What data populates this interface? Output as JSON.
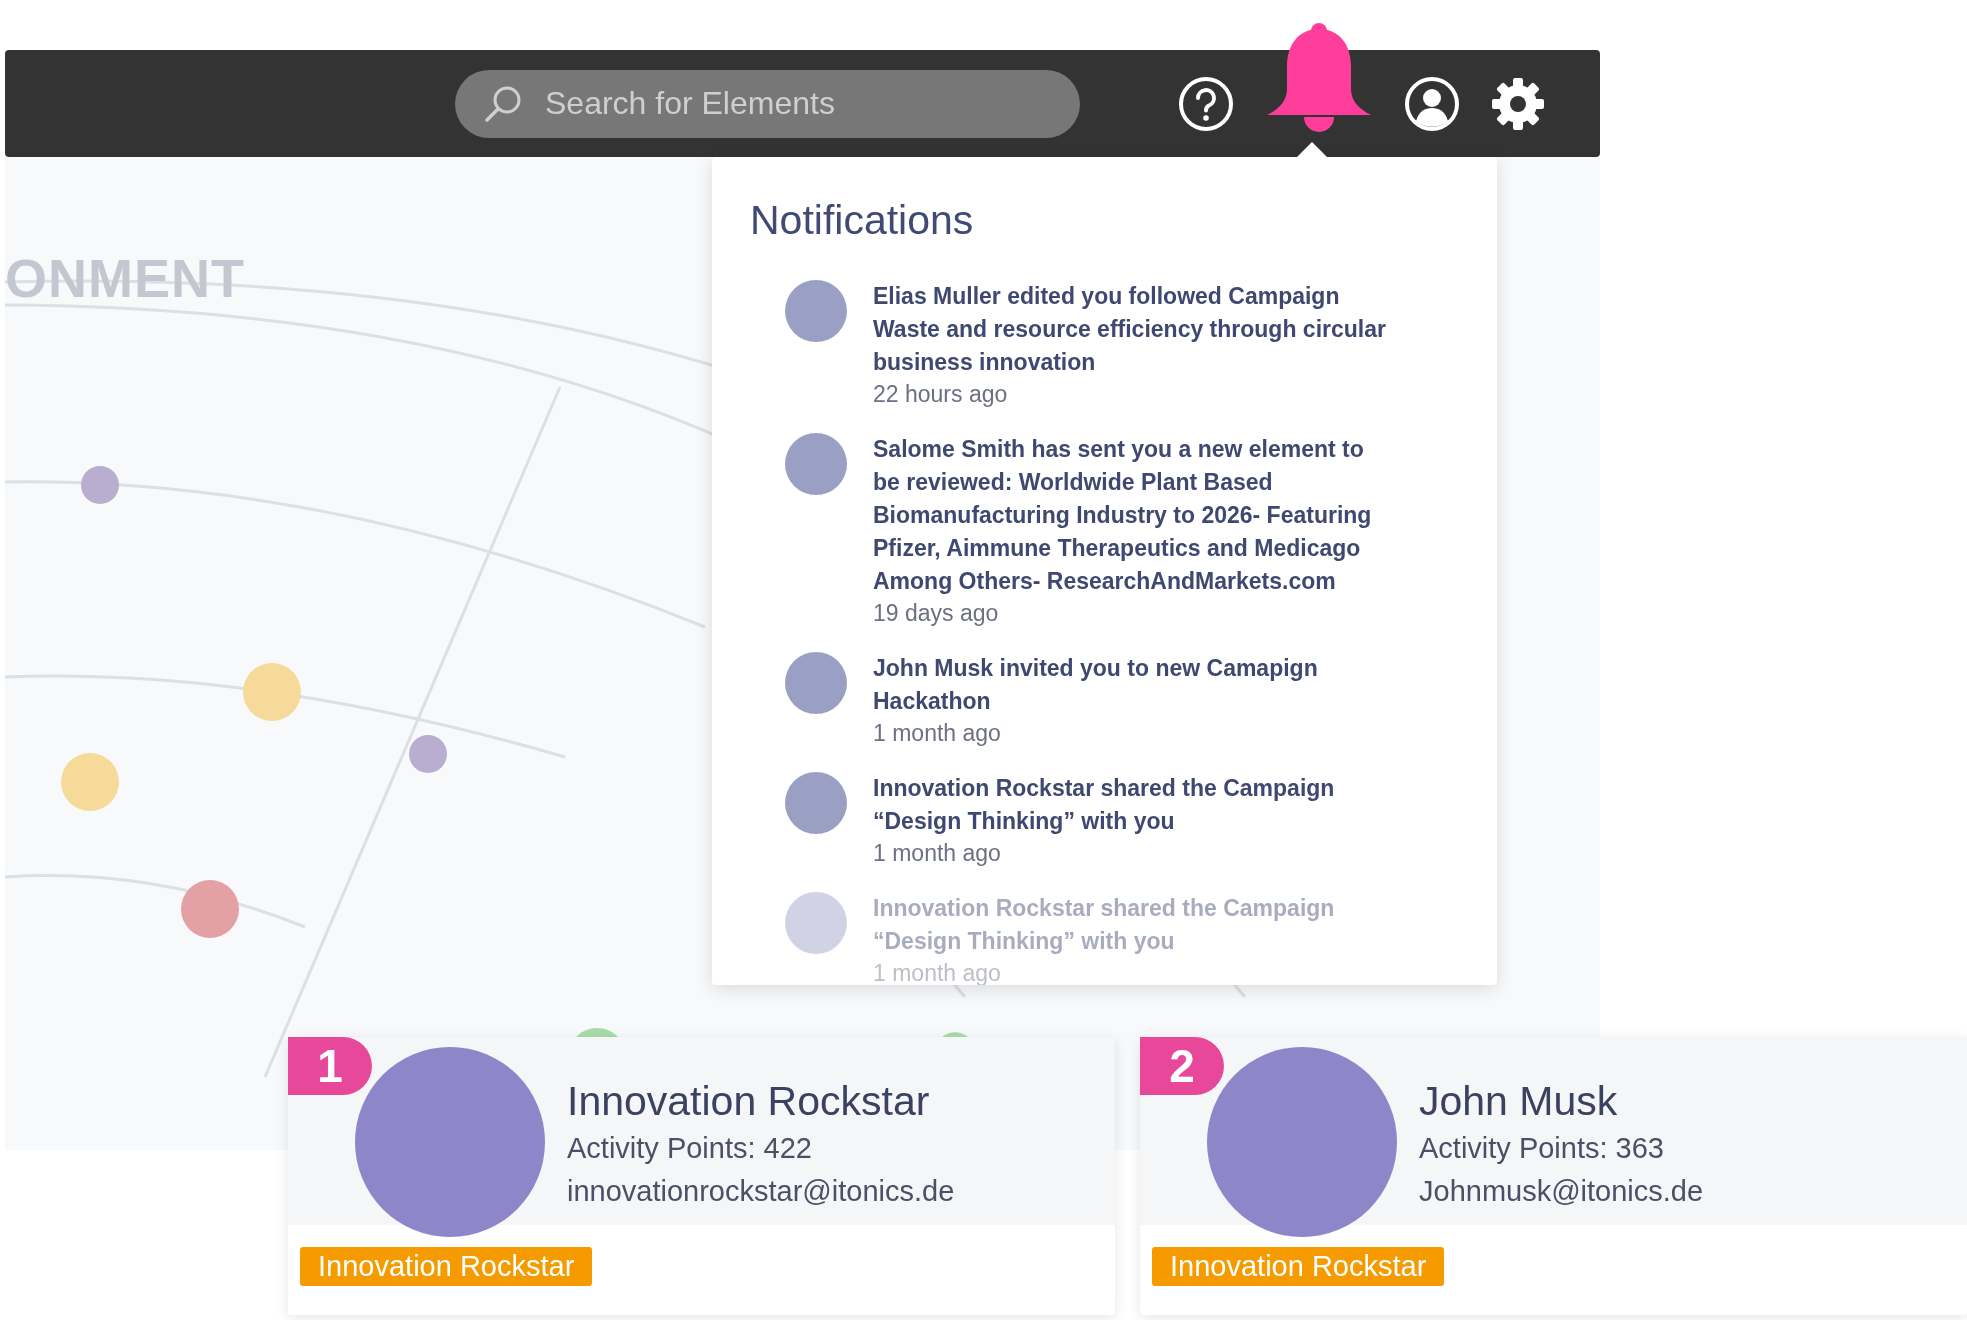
{
  "top_bar": {
    "search": {
      "placeholder": "Search for Elements"
    },
    "icons": [
      {
        "kind": "help",
        "selected": false
      },
      {
        "kind": "bell",
        "selected": true
      },
      {
        "kind": "user",
        "selected": false
      },
      {
        "kind": "settings",
        "selected": false
      }
    ]
  },
  "page": {
    "heading": "ONMENT"
  },
  "notifications": {
    "title": "Notifications",
    "items": [
      {
        "text": "Elias Muller edited you followed Campaign Waste and resource efficiency through circular business innovation",
        "time": "22 hours ago",
        "faded": false
      },
      {
        "text": "Salome Smith has sent you a new element to be reviewed: Worldwide Plant Based Biomanufacturing Industry to 2026- Featuring Pfizer, Aimmune Therapeutics and Medicago Among Others- ResearchAndMarkets.com",
        "time": "19 days ago",
        "faded": false
      },
      {
        "text": "John Musk invited you to new Camapign Hackathon",
        "time": "1 month ago",
        "faded": false
      },
      {
        "text": "Innovation Rockstar shared the Campaign “Design Thinking” with you",
        "time": "1 month ago",
        "faded": false
      },
      {
        "text": "Innovation Rockstar shared the Campaign “Design Thinking” with you",
        "time": "1 month ago",
        "faded": true
      }
    ]
  },
  "leaderboard": [
    {
      "rank": "1",
      "name": "Innovation Rockstar",
      "points": "Activity Points: 422",
      "email": "innovationrockstar@itonics.de",
      "tag": "Innovation Rockstar"
    },
    {
      "rank": "2",
      "name": "John Musk",
      "points": "Activity Points: 363",
      "email": "Johnmusk@itonics.de",
      "tag": "Innovation Rockstar"
    }
  ]
}
